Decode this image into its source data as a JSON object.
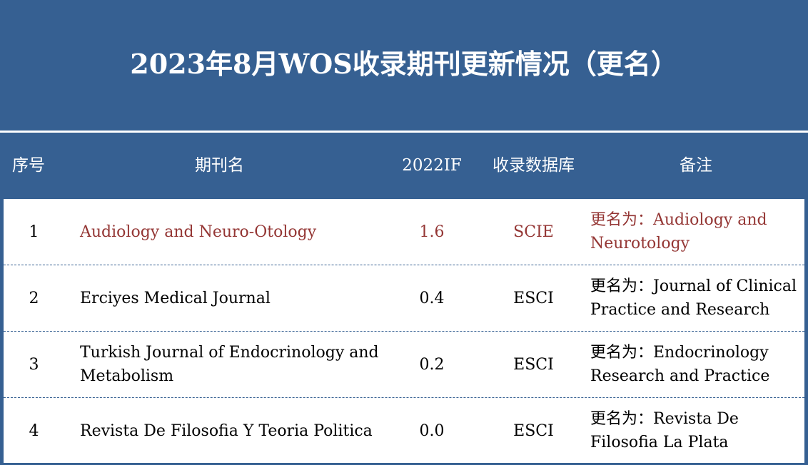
{
  "title": "2023年8月WOS收录期刊更新情况（更名）",
  "colors": {
    "band": "#366092",
    "highlight_text": "#943634",
    "body_text": "#000000",
    "header_text": "#ffffff"
  },
  "columns": [
    "序号",
    "期刊名",
    "2022IF",
    "收录数据库",
    "备注"
  ],
  "rows": [
    {
      "index": "1",
      "journal": "Audiology and Neuro-Otology",
      "if": "1.6",
      "db": "SCIE",
      "note": "更名为：Audiology and Neurotology",
      "highlight": true
    },
    {
      "index": "2",
      "journal": "Erciyes Medical Journal",
      "if": "0.4",
      "db": "ESCI",
      "note": "更名为：Journal of Clinical Practice and Research",
      "highlight": false
    },
    {
      "index": "3",
      "journal": "Turkish Journal of Endocrinology and Metabolism",
      "if": "0.2",
      "db": "ESCI",
      "note": "更名为：Endocrinology Research and Practice",
      "highlight": false
    },
    {
      "index": "4",
      "journal": "Revista De Filosofia Y Teoria Politica",
      "if": "0.0",
      "db": "ESCI",
      "note": "更名为：Revista De Filosofia La Plata",
      "highlight": false
    }
  ]
}
